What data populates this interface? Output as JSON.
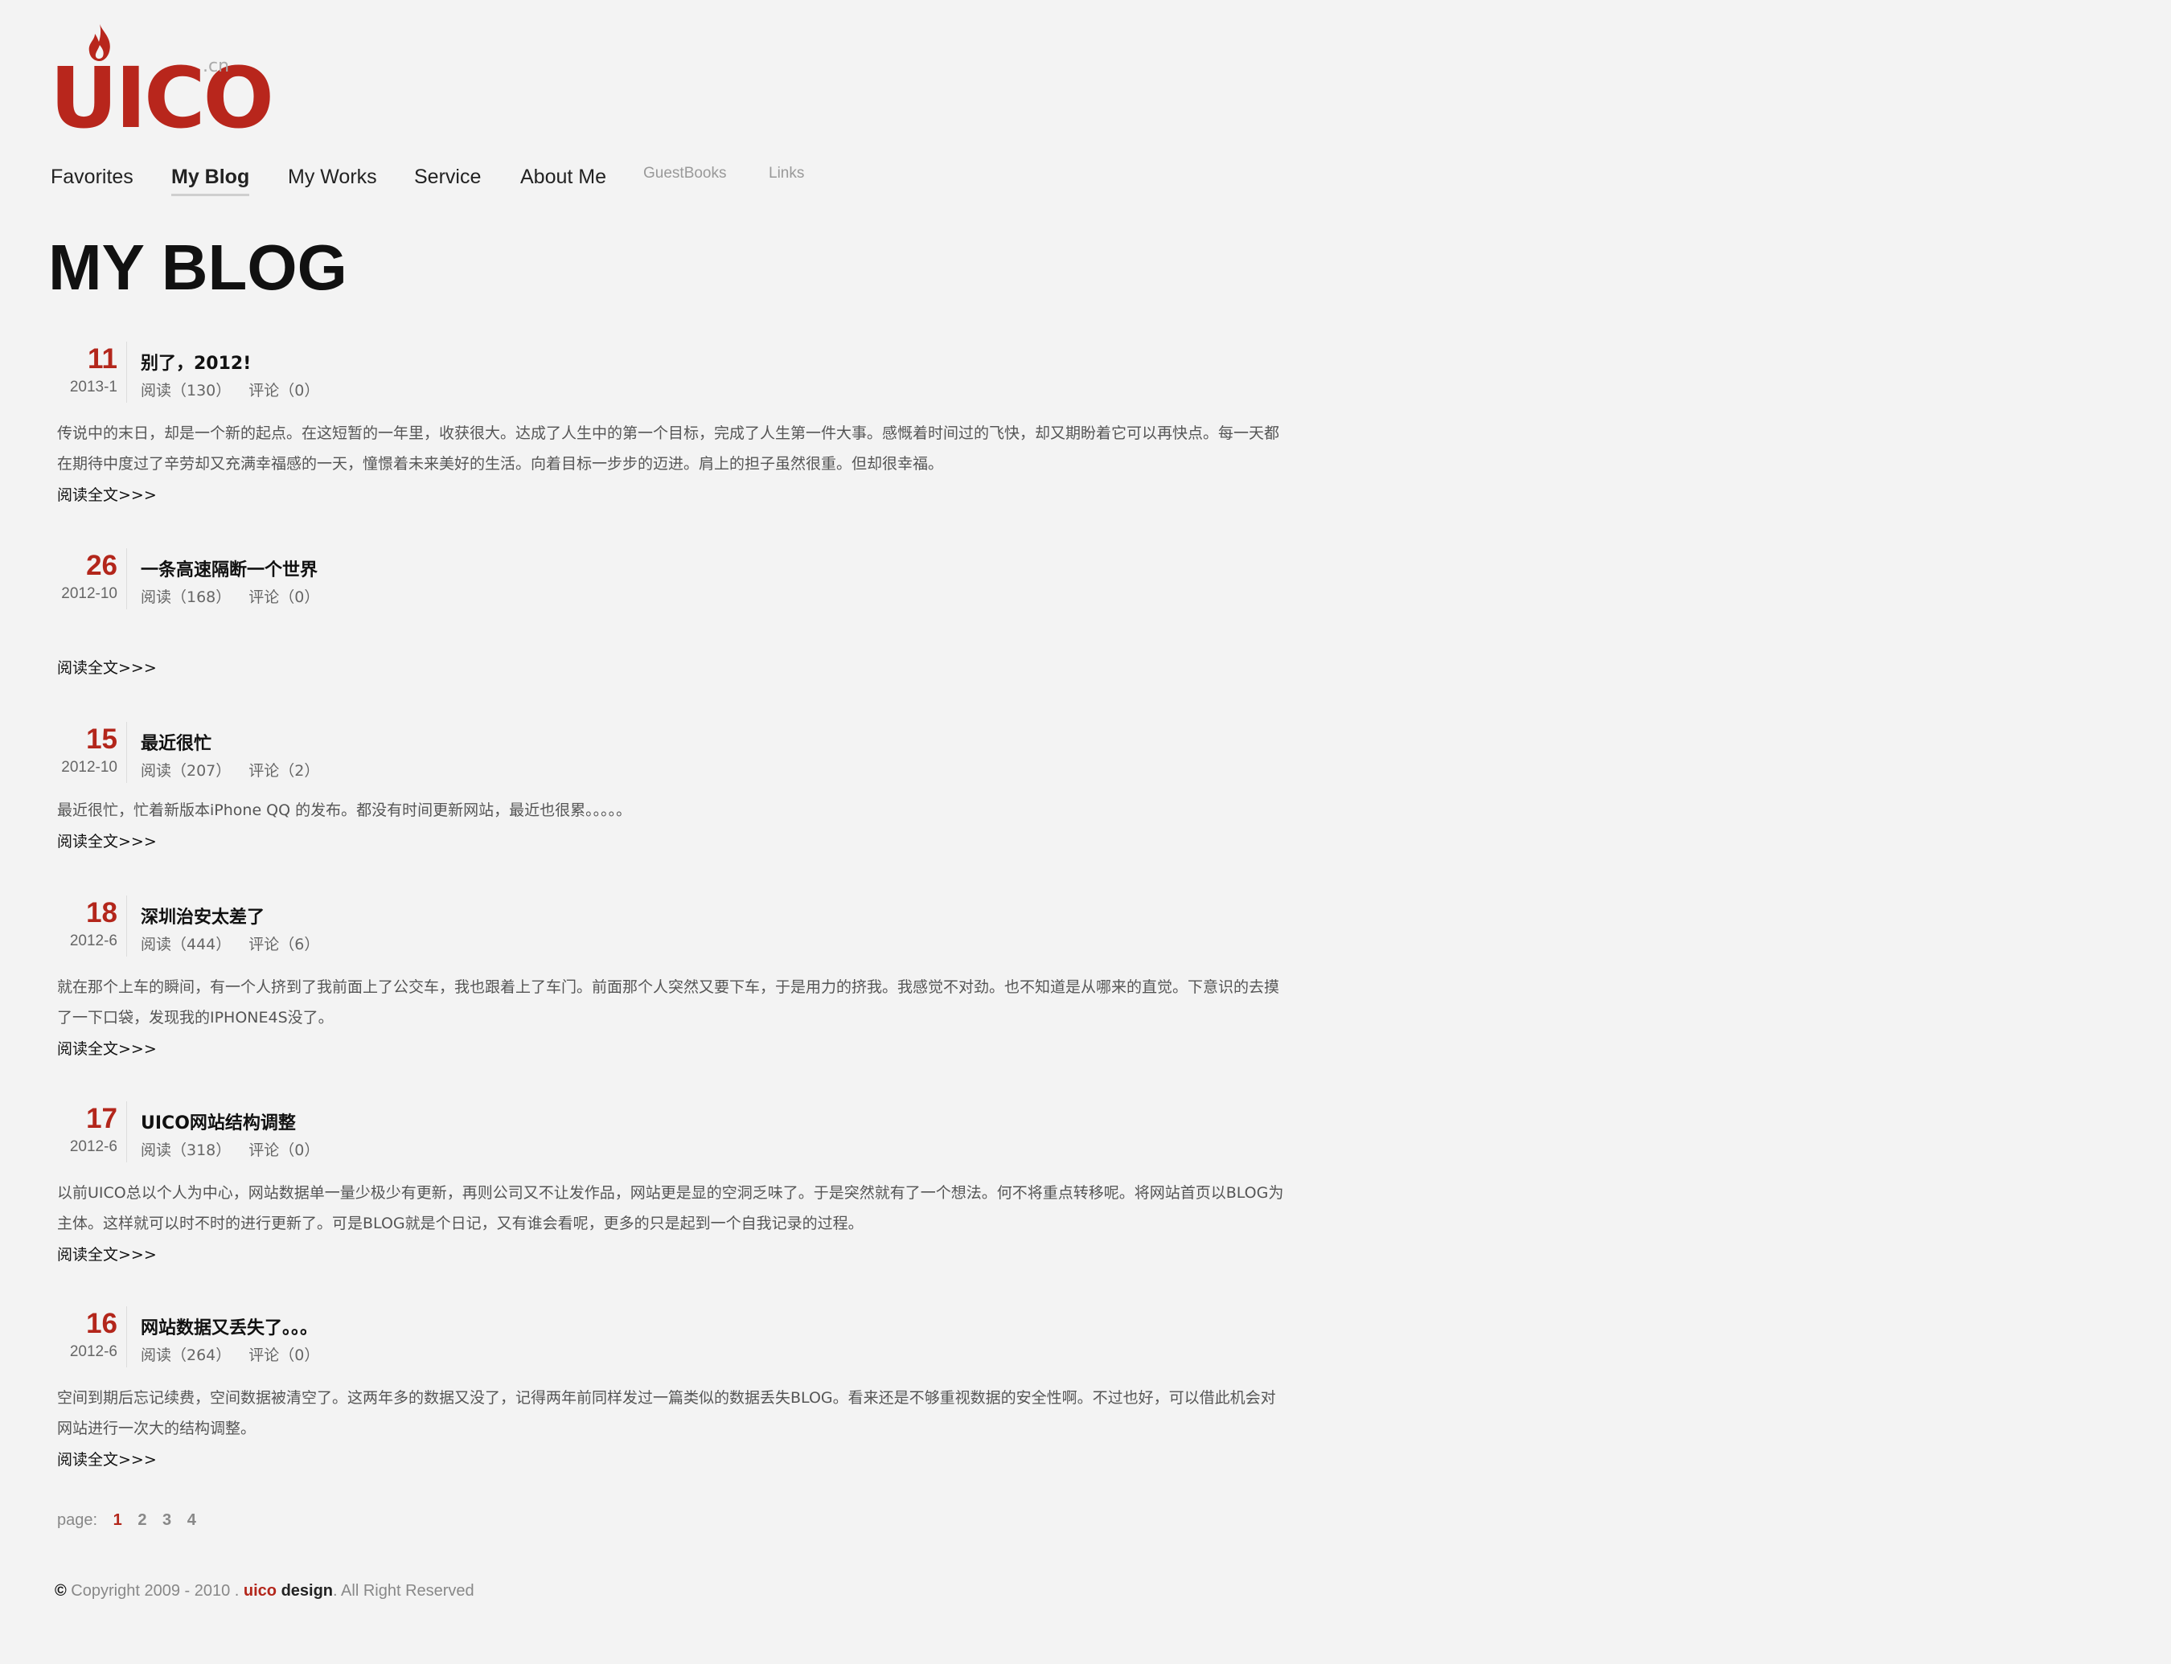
{
  "brand": {
    "logo_text": "UICO",
    "logo_suffix": ".cn",
    "accent_color": "#b3261b"
  },
  "nav": {
    "items": [
      {
        "label": "Favorites"
      },
      {
        "label": "My Blog"
      },
      {
        "label": "My Works"
      },
      {
        "label": "Service"
      },
      {
        "label": "About Me"
      },
      {
        "label": "GuestBooks"
      },
      {
        "label": "Links"
      }
    ],
    "active": "My Blog"
  },
  "page": {
    "title": "MY BLOG"
  },
  "posts": [
    {
      "day": "11",
      "year_month": "2013-1",
      "title": "别了，2012!",
      "reads": "阅读（130）",
      "comments": "评论（0）",
      "excerpt": "传说中的末日，却是一个新的起点。在这短暂的一年里，收获很大。达成了人生中的第一个目标，完成了人生第一件大事。感慨着时间过的飞快，却又期盼着它可以再快点。每一天都在期待中度过了辛劳却又充满幸福感的一天，憧憬着未来美好的生活。向着目标一步步的迈进。肩上的担子虽然很重。但却很幸福。",
      "read_more": "阅读全文>>>"
    },
    {
      "day": "26",
      "year_month": "2012-10",
      "title": "一条高速隔断一个世界",
      "reads": "阅读（168）",
      "comments": "评论（0）",
      "excerpt": "",
      "read_more": "阅读全文>>>"
    },
    {
      "day": "15",
      "year_month": "2012-10",
      "title": "最近很忙",
      "reads": "阅读（207）",
      "comments": "评论（2）",
      "excerpt": "最近很忙，忙着新版本iPhone QQ 的发布。都没有时间更新网站，最近也很累。。。。。",
      "read_more": "阅读全文>>>"
    },
    {
      "day": "18",
      "year_month": "2012-6",
      "title": "深圳治安太差了",
      "reads": "阅读（444）",
      "comments": "评论（6）",
      "excerpt": "就在那个上车的瞬间，有一个人挤到了我前面上了公交车，我也跟着上了车门。前面那个人突然又要下车，于是用力的挤我。我感觉不对劲。也不知道是从哪来的直觉。下意识的去摸了一下口袋，发现我的IPHONE4S没了。",
      "read_more": "阅读全文>>>"
    },
    {
      "day": "17",
      "year_month": "2012-6",
      "title": "UICO网站结构调整",
      "reads": "阅读（318）",
      "comments": "评论（0）",
      "excerpt": "以前UICO总以个人为中心，网站数据单一量少极少有更新，再则公司又不让发作品，网站更是显的空洞乏味了。于是突然就有了一个想法。何不将重点转移呢。将网站首页以BLOG为主体。这样就可以时不时的进行更新了。可是BLOG就是个日记，又有谁会看呢，更多的只是起到一个自我记录的过程。",
      "read_more": "阅读全文>>>"
    },
    {
      "day": "16",
      "year_month": "2012-6",
      "title": "网站数据又丢失了。。。",
      "reads": "阅读（264）",
      "comments": "评论（0）",
      "excerpt": "空间到期后忘记续费，空间数据被清空了。这两年多的数据又没了，记得两年前同样发过一篇类似的数据丢失BLOG。看来还是不够重视数据的安全性啊。不过也好，可以借此机会对网站进行一次大的结构调整。",
      "read_more": "阅读全文>>>"
    }
  ],
  "pager": {
    "label": "page:",
    "pages": [
      "1",
      "2",
      "3",
      "4"
    ],
    "current": "1"
  },
  "footer": {
    "symbol": "©",
    "text_before": " Copyright 2009 - 2010 . ",
    "brand_red": "uico",
    "brand_dark": " design",
    "text_after": ". All Right Reserved"
  }
}
